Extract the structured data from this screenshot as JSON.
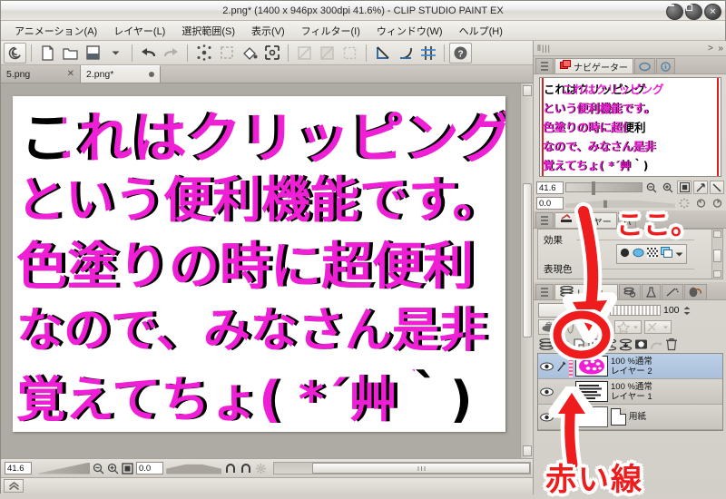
{
  "window": {
    "title": "2.png* (1400 x 946px 300dpi 41.6%)  - CLIP STUDIO PAINT EX",
    "controls": [
      {
        "name": "minimize",
        "glyph": "–"
      },
      {
        "name": "maximize",
        "glyph": "□"
      },
      {
        "name": "close",
        "glyph": "✕"
      }
    ]
  },
  "menubar": {
    "items": [
      {
        "label": "アニメーション(A)"
      },
      {
        "label": "レイヤー(L)"
      },
      {
        "label": "選択範囲(S)"
      },
      {
        "label": "表示(V)"
      },
      {
        "label": "フィルター(I)"
      },
      {
        "label": "ウィンドウ(W)"
      },
      {
        "label": "ヘルプ(H)"
      }
    ]
  },
  "toolbar": {
    "buttons": [
      {
        "name": "clip-studio-logo-icon"
      },
      {
        "name": "new-file-icon"
      },
      {
        "name": "open-file-icon"
      },
      {
        "name": "save-file-icon"
      },
      {
        "name": "save-dropdown-icon"
      },
      {
        "name": "undo-icon"
      },
      {
        "name": "redo-icon"
      },
      {
        "name": "clear-selection-icon"
      },
      {
        "name": "fill-selection-icon"
      },
      {
        "name": "fill-bucket-icon"
      },
      {
        "name": "transform-icon"
      },
      {
        "name": "scale-rotate-icon"
      },
      {
        "name": "gradient-icon"
      },
      {
        "name": "select-rect-icon"
      },
      {
        "name": "ruler-snap-icon"
      },
      {
        "name": "perspective-snap-icon"
      },
      {
        "name": "symmetry-snap-icon"
      },
      {
        "name": "help-icon"
      }
    ]
  },
  "tabs": [
    {
      "label": "5.png",
      "active": false,
      "marker": "close"
    },
    {
      "label": "2.png*",
      "active": true,
      "marker": "dot"
    }
  ],
  "canvas": {
    "lines": [
      "これはクリッピング",
      "という便利機能です。",
      "色塗りの時に超便利",
      "なので、みなさん是非",
      "覚えてちょ( *´艸｀)"
    ],
    "text_color_base": "#000000",
    "text_color_overlay": "#ef1fd6",
    "paper_color": "#ffffff"
  },
  "statusbar": {
    "zoom_value": "41.6",
    "rotation_value": "0.0",
    "buttons": [
      {
        "name": "zoom-out-icon"
      },
      {
        "name": "zoom-in-icon"
      },
      {
        "name": "fit-screen-icon"
      },
      {
        "name": "rotate-left-icon"
      },
      {
        "name": "rotate-right-icon"
      },
      {
        "name": "reset-rotation-icon"
      }
    ]
  },
  "dock": {
    "navigator": {
      "tabs": [
        {
          "label": "ナビゲーター",
          "icon": "navigator-icon",
          "selected": true
        },
        {
          "label": "",
          "icon": "subview-icon",
          "selected": false
        },
        {
          "label": "",
          "icon": "info-icon",
          "selected": false
        }
      ],
      "preview_lines": [
        "これはクリッピング",
        "という便利機能です。",
        "色塗りの時に超便利",
        "なので、みなさん是非",
        "覚えてちょ( *´艸｀)"
      ],
      "zoom_value": "41.6",
      "rotation_value": "0.0",
      "buttons": [
        {
          "name": "nav-zoom-out-icon"
        },
        {
          "name": "nav-zoom-in-icon"
        },
        {
          "name": "nav-fit-icon"
        },
        {
          "name": "nav-rotate-icon"
        },
        {
          "name": "nav-flip-icon"
        },
        {
          "name": "nav-rotate-left-icon"
        },
        {
          "name": "nav-rotate-right-icon"
        },
        {
          "name": "nav-reset-icon"
        }
      ]
    },
    "layer_property": {
      "tabs": [
        {
          "label": "レイヤー",
          "icon": "layer-property-icon",
          "selected": true
        },
        {
          "label": "パ",
          "icon": "palette-icon",
          "selected": false
        }
      ],
      "rows": [
        {
          "label": "効果"
        },
        {
          "label": "表現色"
        }
      ],
      "effect_buttons": [
        {
          "name": "border-effect-icon"
        },
        {
          "name": "tone-effect-icon"
        },
        {
          "name": "texture-effect-icon"
        },
        {
          "name": "color-effect-icon"
        },
        {
          "name": "effect-dropdown-icon"
        }
      ]
    },
    "layer_panel": {
      "tabs": [
        {
          "label": "レイヤー",
          "icon": "layers-icon",
          "selected": true
        },
        {
          "label": "",
          "icon": "layer-search-icon",
          "selected": false
        },
        {
          "label": "",
          "icon": "material-icon",
          "selected": false
        },
        {
          "label": "",
          "icon": "quickaccess-icon",
          "selected": false
        },
        {
          "label": "",
          "icon": "subtool-icon",
          "selected": false
        }
      ],
      "blend_mode": "",
      "opacity_value": "100",
      "tool_buttons": [
        {
          "name": "clip-to-layer-below-icon"
        },
        {
          "name": "layer-mask-icon"
        },
        {
          "name": "lock-layer-icon"
        },
        {
          "name": "lock-transparent-pixels-icon"
        },
        {
          "name": "ruler-range-icon"
        },
        {
          "name": "mask-range-icon"
        },
        {
          "name": "new-raster-layer-icon"
        },
        {
          "name": "new-layer-folder-icon"
        },
        {
          "name": "duplicate-layer-icon"
        },
        {
          "name": "merge-down-icon"
        },
        {
          "name": "combine-layers-icon"
        },
        {
          "name": "layer-mask-create-icon"
        },
        {
          "name": "layer-color-icon"
        },
        {
          "name": "delete-layer-icon"
        }
      ],
      "layers": [
        {
          "name": "レイヤー 2",
          "blend": "100 %通常",
          "selected": true,
          "clipped": true,
          "visible": true,
          "thumb": "pink-blob"
        },
        {
          "name": "レイヤー 1",
          "blend": "100 %通常",
          "selected": false,
          "clipped": false,
          "visible": true,
          "thumb": "text-thumb"
        },
        {
          "name": "用紙",
          "blend": "",
          "selected": false,
          "clipped": false,
          "visible": true,
          "thumb": "paper"
        }
      ]
    }
  },
  "annotations": [
    {
      "name": "koko-note",
      "text": "ここ。",
      "color": "#ee1c1c"
    },
    {
      "name": "akai-sen-note",
      "text": "赤い線",
      "color": "#ee1c1c"
    },
    {
      "name": "arrow-to-clip-button",
      "text": "",
      "color": "#ee1c1c"
    },
    {
      "name": "circle-clip-button",
      "text": "",
      "color": "#ee1c1c"
    },
    {
      "name": "arrow-to-clip-stripe",
      "text": "",
      "color": "#ee1c1c"
    }
  ]
}
